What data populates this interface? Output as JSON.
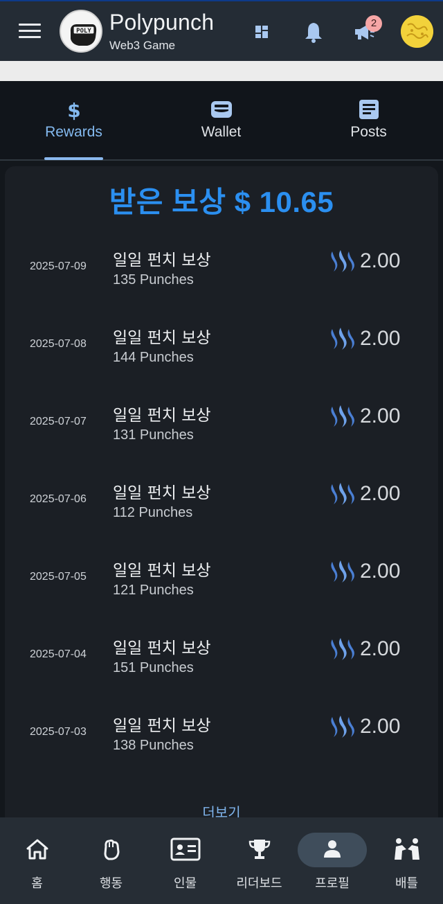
{
  "header": {
    "title": "Polypunch",
    "subtitle": "Web3 Game",
    "logo_text": "POLY",
    "notification_badge": "2"
  },
  "tabs": [
    {
      "label": "Rewards",
      "icon": "dollar-icon",
      "active": true
    },
    {
      "label": "Wallet",
      "icon": "wallet-icon",
      "active": false
    },
    {
      "label": "Posts",
      "icon": "document-icon",
      "active": false
    }
  ],
  "rewards": {
    "total_label": "받은 보상 $ 10.65",
    "items": [
      {
        "date": "2025-07-09",
        "name": "일일 펀치 보상",
        "punches": "135 Punches",
        "amount": "2.00"
      },
      {
        "date": "2025-07-08",
        "name": "일일 펀치 보상",
        "punches": "144 Punches",
        "amount": "2.00"
      },
      {
        "date": "2025-07-07",
        "name": "일일 펀치 보상",
        "punches": "131 Punches",
        "amount": "2.00"
      },
      {
        "date": "2025-07-06",
        "name": "일일 펀치 보상",
        "punches": "112 Punches",
        "amount": "2.00"
      },
      {
        "date": "2025-07-05",
        "name": "일일 펀치 보상",
        "punches": "121 Punches",
        "amount": "2.00"
      },
      {
        "date": "2025-07-04",
        "name": "일일 펀치 보상",
        "punches": "151 Punches",
        "amount": "2.00"
      },
      {
        "date": "2025-07-03",
        "name": "일일 펀치 보상",
        "punches": "138 Punches",
        "amount": "2.00"
      }
    ],
    "more_label": "더보기"
  },
  "bottom_nav": [
    {
      "label": "홈",
      "icon": "home-icon"
    },
    {
      "label": "행동",
      "icon": "fist-icon"
    },
    {
      "label": "인물",
      "icon": "id-card-icon"
    },
    {
      "label": "리더보드",
      "icon": "trophy-icon"
    },
    {
      "label": "프로필",
      "icon": "user-icon",
      "active": true
    },
    {
      "label": "배틀",
      "icon": "battle-icon"
    }
  ],
  "colors": {
    "accent": "#2b8ff0",
    "tab_active": "#84baf0",
    "header_bg": "#242c35",
    "steem_blue": "#4a7fd4"
  }
}
